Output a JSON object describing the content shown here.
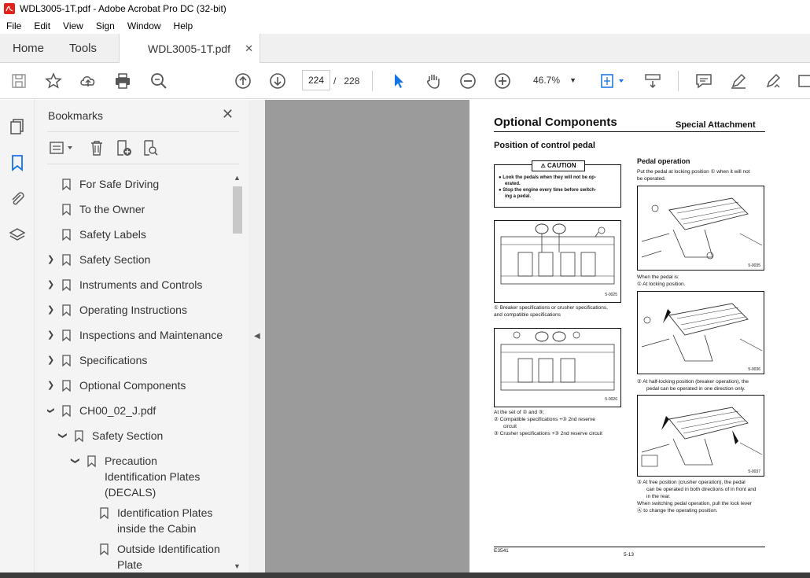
{
  "window": {
    "title": "WDL3005-1T.pdf - Adobe Acrobat Pro DC (32-bit)"
  },
  "menu": [
    "File",
    "Edit",
    "View",
    "Sign",
    "Window",
    "Help"
  ],
  "tabs": {
    "home": "Home",
    "tools": "Tools",
    "document": "WDL3005-1T.pdf"
  },
  "toolbar": {
    "current_page": "224",
    "page_sep": "/",
    "total_pages": "228",
    "zoom": "46.7%"
  },
  "panel": {
    "title": "Bookmarks",
    "items": [
      {
        "label": "For Safe Driving"
      },
      {
        "label": "To the Owner"
      },
      {
        "label": "Safety Labels"
      },
      {
        "label": "Safety Section"
      },
      {
        "label": "Instruments and Controls"
      },
      {
        "label": "Operating Instructions"
      },
      {
        "label": "Inspections and Maintenance"
      },
      {
        "label": "Specifications"
      },
      {
        "label": "Optional Components"
      },
      {
        "label": "CH00_02_J.pdf"
      },
      {
        "label": "Safety Section"
      },
      {
        "label": "Precaution"
      },
      {
        "label": "Identification Plates"
      },
      {
        "label": "(DECALS)"
      },
      {
        "label": "Identification Plates"
      },
      {
        "label": "inside the Cabin"
      },
      {
        "label": "Outside Identification"
      },
      {
        "label": "Plate"
      }
    ]
  },
  "doc": {
    "heading": "Optional Components",
    "section_right": "Special Attachment",
    "subheading": "Position of control pedal",
    "caution_label": "CAUTION",
    "caution_line1": "Look the pedals when they will not be op-",
    "caution_line2": "erated.",
    "caution_line3": "Stop the engine every time before switch-",
    "caution_line4": "ing a pedal.",
    "fig1_code": "5-0025",
    "fig1_caption1": "① Breaker specifications or crusher specifications,",
    "fig1_caption2": "and compatible specifications",
    "fig2_code": "5-0026",
    "set_text": "At the set of ② and ③;",
    "set_item1a": "②  Compatible specifications +③ 2nd reserve",
    "set_item1b": "circuit",
    "set_item2": "③  Crusher specifications +③ 2nd reserve circuit",
    "pedal_op": "Pedal operation",
    "pedal_text1": "Put the pedal at locking position ① when it will not",
    "pedal_text2": "be operated.",
    "fig3_code": "5-0035",
    "when_text": "When the pedal is:",
    "locking": "①  At locking position.",
    "fig4_code": "5-0036",
    "half1": "②  At half-locking position (breaker operation), the",
    "half2": "pedal can be operated in one direction only.",
    "fig5_code": "5-0037",
    "free1": "③  At free position (crusher operation), the pedal",
    "free2": "can be operated in both directions of in front and",
    "free3": "in the rear.",
    "switch1": "When switching pedal operation, pull the lock lever",
    "switch2": "Ⓐ to change the operating position.",
    "footer_left": "E3541",
    "footer_page": "5-13"
  },
  "colors": {
    "accent": "#1473e6",
    "viewer_bg": "#9b9b9b",
    "pdf_red": "#e2231a"
  }
}
